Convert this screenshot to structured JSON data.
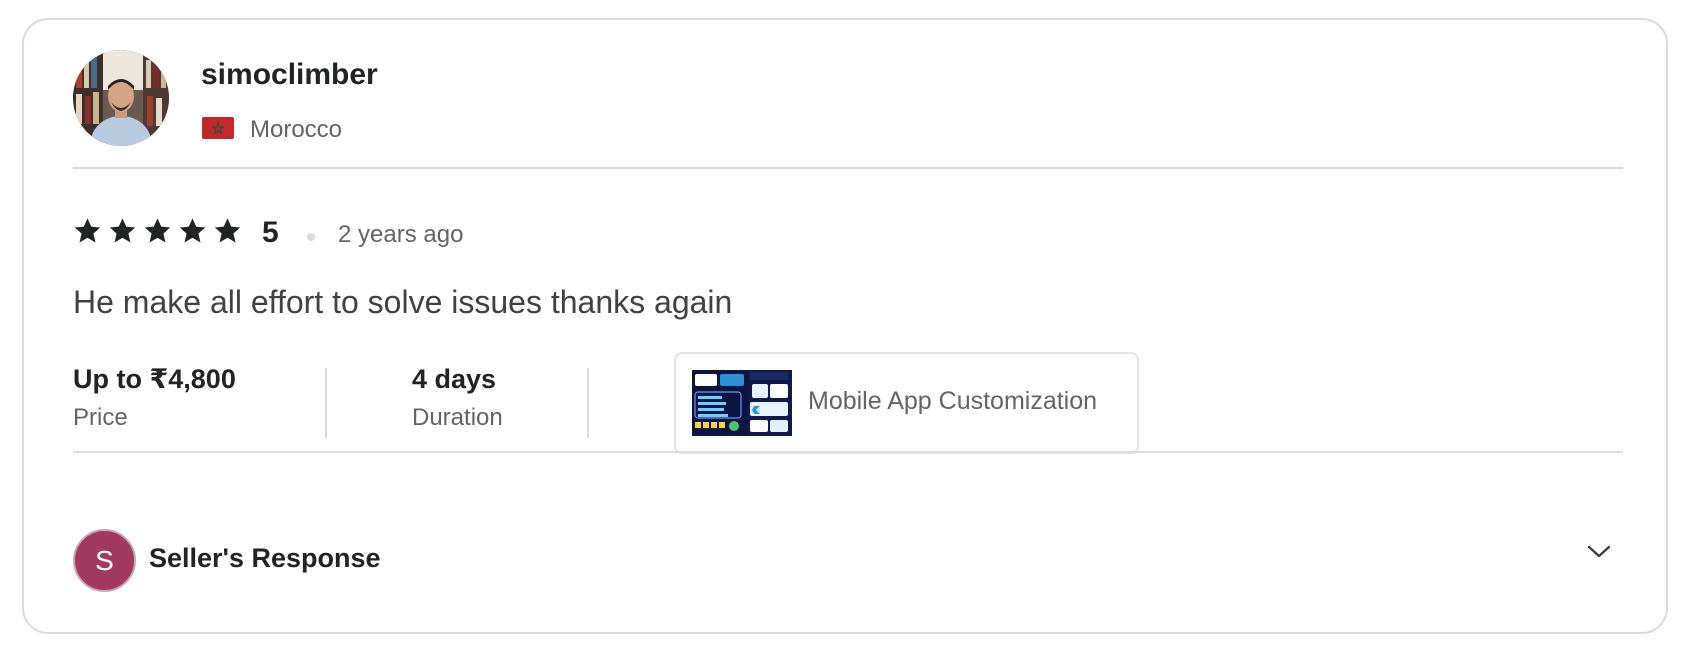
{
  "reviewer": {
    "username": "simoclimber",
    "country": "Morocco"
  },
  "review": {
    "rating_stars": 5,
    "rating_value": "5",
    "time_ago": "2 years ago",
    "text": "He make all effort to solve issues thanks again"
  },
  "meta": {
    "price_value": "Up to ₹4,800",
    "price_label": "Price",
    "duration_value": "4 days",
    "duration_label": "Duration"
  },
  "gig": {
    "title": "Mobile App Customization"
  },
  "seller_response": {
    "initial": "S",
    "title": "Seller's Response"
  },
  "colors": {
    "star": "#222325",
    "seller_avatar_bg": "#a2395e",
    "flag_red": "#c1272d",
    "flag_green": "#006233"
  }
}
